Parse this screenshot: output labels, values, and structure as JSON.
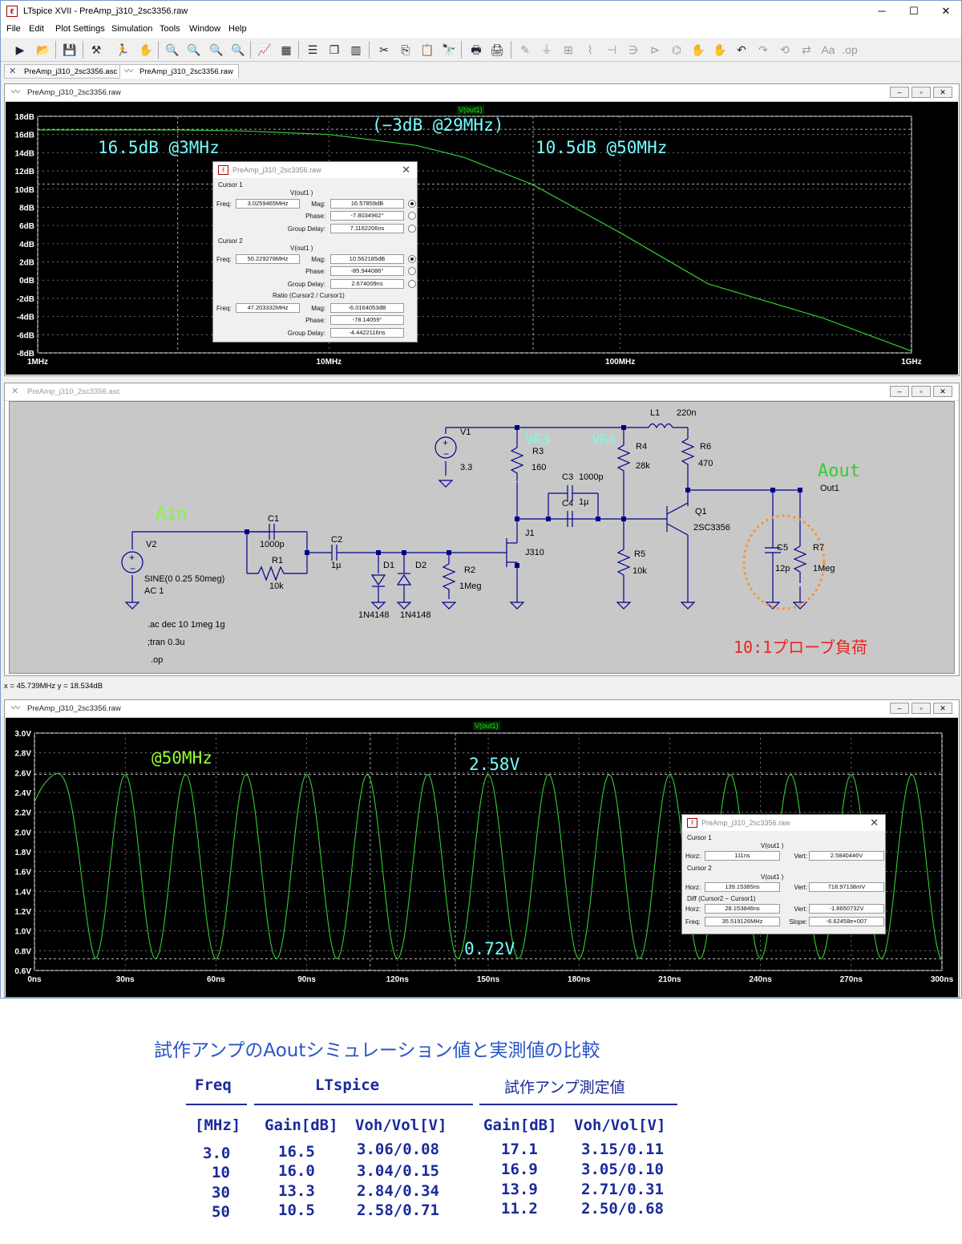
{
  "window": {
    "title": "LTspice XVII - PreAmp_j310_2sc3356.raw",
    "buttons": {
      "min": "─",
      "max": "☐",
      "close": "✕"
    }
  },
  "menu": [
    "File",
    "Edit",
    "Plot Settings",
    "Simulation",
    "Tools",
    "Window",
    "Help"
  ],
  "tabs": [
    {
      "label": "PreAmp_j310_2sc3356.asc"
    },
    {
      "label": "PreAmp_j310_2sc3356.raw"
    }
  ],
  "freq_plot": {
    "title": "PreAmp_j310_2sc3356.raw",
    "trace": "V(out1)",
    "annotations": {
      "a1": "16.5dB @3MHz",
      "a2": "(−3dB @29MHz)",
      "a3": "10.5dB @50MHz"
    },
    "cursor_dialog": {
      "title": "PreAmp_j310_2sc3356.raw",
      "cursor1_label": "Cursor 1",
      "cursor1_trace": "V(out1 )",
      "cursor1_freq": "3.0259465MHz",
      "cursor1_mag": "16.57859dB",
      "cursor1_phase": "-7.8034962°",
      "cursor1_gd": "7.1162206ns",
      "cursor2_label": "Cursor 2",
      "cursor2_trace": "V(out1 )",
      "cursor2_freq": "50.229278MHz",
      "cursor2_mag": "10.562185dB",
      "cursor2_phase": "-85.944086°",
      "cursor2_gd": "2.674009ns",
      "ratio_label": "Ratio (Cursor2 / Cursor1)",
      "ratio_freq": "47.203332MHz",
      "ratio_mag": "-6.0164053dB",
      "ratio_phase": "-78.14059°",
      "ratio_gd": "-4.4422116ns",
      "lbl_freq": "Freq:",
      "lbl_mag": "Mag:",
      "lbl_phase": "Phase:",
      "lbl_gd": "Group Delay:"
    }
  },
  "schematic": {
    "title": "PreAmp_j310_2sc3356.asc",
    "labels": {
      "ain": "Ain",
      "aout": "Aout",
      "out1": "Out1",
      "vr3": "VR3",
      "vr4": "VR4",
      "v1": "V1",
      "v1val": "3.3",
      "v2": "V2",
      "v2val1": "SINE(0 0.25 50meg)",
      "v2val2": "AC 1",
      "c1": "C1",
      "c1val": "1000p",
      "r1": "R1",
      "r1val": "10k",
      "c2": "C2",
      "c2val": "1µ",
      "d1": "D1",
      "d2": "D2",
      "d1val": "1N4148",
      "d2val": "1N4148",
      "r2": "R2",
      "r2val": "1Meg",
      "r3": "R3",
      "r3val": "160",
      "j1": "J1",
      "j1val": "J310",
      "c3": "C3",
      "c3val": "1000p",
      "c4": "C4",
      "c4val": "1µ",
      "r4": "R4",
      "r4val": "28k",
      "l1": "L1",
      "l1val": "220n",
      "r6": "R6",
      "r6val": "470",
      "r5": "R5",
      "r5val": "10k",
      "q1": "Q1",
      "q1val": "2SC3356",
      "c5": "C5",
      "c5val": "12p",
      "r7": "R7",
      "r7val": "1Meg",
      "probe": "10:1プローブ負荷",
      "dir1": ".ac dec 10 1meg 1g",
      "dir2": ";tran 0.3u",
      "dir3": ".op"
    }
  },
  "status": "x = 45.739MHz   y = 18.534dB",
  "time_plot": {
    "title": "PreAmp_j310_2sc3356.raw",
    "trace": "V(out1)",
    "annotations": {
      "a1": "@50MHz",
      "a2": "2.58V",
      "a3": "0.72V"
    },
    "cursor_dialog": {
      "title": "PreAmp_j310_2sc3356.raw",
      "c1_label": "Cursor 1",
      "c1_trace": "V(out1 )",
      "c1_horz": "111ns",
      "c1_vert": "2.5840446V",
      "c2_label": "Cursor 2",
      "c2_trace": "V(out1 )",
      "c2_horz": "139.15385ns",
      "c2_vert": "718.97138mV",
      "diff_label": "Diff (Cursor2 − Cursor1)",
      "d_horz": "28.153846ns",
      "d_vert": "-1.8650732V",
      "d_freq": "35.519126MHz",
      "d_slope": "-6.62458e+007",
      "lbl_horz": "Horz:",
      "lbl_vert": "Vert:",
      "lbl_freq": "Freq:",
      "lbl_slope": "Slope:"
    }
  },
  "freq_chart": {
    "type": "line",
    "series": [
      {
        "name": "V(out1)",
        "x": [
          1,
          2,
          3,
          5,
          10,
          20,
          29,
          50,
          100,
          200,
          500,
          1000
        ],
        "y": [
          16.5,
          16.5,
          16.5,
          16.4,
          16.0,
          14.8,
          13.5,
          10.5,
          5.2,
          -0.4,
          -4.2,
          -7.8
        ]
      }
    ],
    "x_unit": "MHz",
    "x_scale": "log",
    "xlim": [
      1,
      1000
    ],
    "ylim": [
      -8,
      18
    ],
    "y_ticks": [
      "18dB",
      "16dB",
      "14dB",
      "12dB",
      "10dB",
      "8dB",
      "6dB",
      "4dB",
      "2dB",
      "0dB",
      "-2dB",
      "-4dB",
      "-6dB",
      "-8dB"
    ],
    "x_ticks": [
      "1MHz",
      "10MHz",
      "100MHz",
      "1GHz"
    ],
    "grid": true,
    "color": "#33cc33"
  },
  "time_chart": {
    "type": "line",
    "series": [
      {
        "name": "V(out1)",
        "freq_mhz": 50,
        "vmax": 2.58,
        "vmin": 0.72
      }
    ],
    "x_unit": "ns",
    "xlim": [
      0,
      300
    ],
    "ylim": [
      0.6,
      3.0
    ],
    "y_ticks": [
      "3.0V",
      "2.8V",
      "2.6V",
      "2.4V",
      "2.2V",
      "2.0V",
      "1.8V",
      "1.6V",
      "1.4V",
      "1.2V",
      "1.0V",
      "0.8V",
      "0.6V"
    ],
    "x_ticks": [
      "0ns",
      "30ns",
      "60ns",
      "90ns",
      "120ns",
      "150ns",
      "180ns",
      "210ns",
      "240ns",
      "270ns",
      "300ns"
    ],
    "grid": true,
    "color": "#33cc33"
  },
  "comparison": {
    "title": "試作アンプのAoutシミュレーション値と実測値の比較",
    "h_freq": "Freq",
    "h_lt": "LTspice",
    "h_meas": "試作アンプ測定値",
    "unit_freq": "[MHz]",
    "unit_gain1": "Gain[dB]",
    "unit_v1": "Voh/Vol[V]",
    "unit_gain2": "Gain[dB]",
    "unit_v2": "Voh/Vol[V]",
    "rows": [
      [
        "3.0",
        "16.5",
        "3.06/0.08",
        "17.1",
        "3.15/0.11"
      ],
      [
        "10",
        "16.0",
        "3.04/0.15",
        "16.9",
        "3.05/0.10"
      ],
      [
        "30",
        "13.3",
        "2.84/0.34",
        "13.9",
        "2.71/0.31"
      ],
      [
        "50",
        "10.5",
        "2.58/0.71",
        "11.2",
        "2.50/0.68"
      ]
    ]
  }
}
